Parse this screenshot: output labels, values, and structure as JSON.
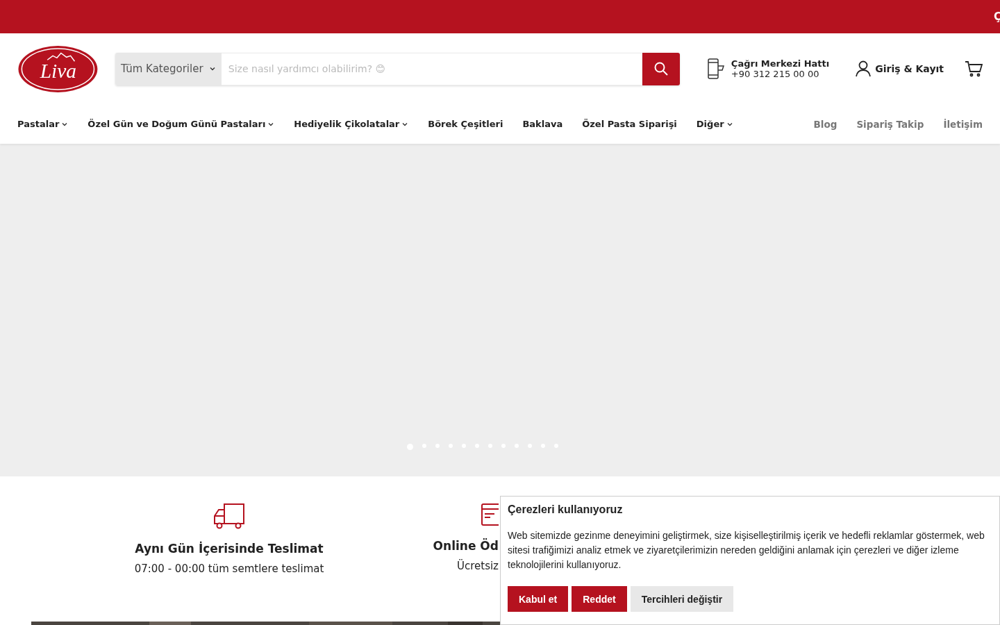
{
  "announcement_bar": {
    "text": "Ç"
  },
  "header": {
    "logo_text": "Liva",
    "category_select": "Tüm Kategoriler",
    "search": {
      "placeholder": "Size nasıl yardımcı olabilirim? 😊"
    },
    "call_center": {
      "title": "Çağrı Merkezi Hattı",
      "phone": "+90 312 215 00 00"
    },
    "account": "Giriş & Kayıt"
  },
  "nav": {
    "items": [
      {
        "label": "Pastalar",
        "has_menu": true
      },
      {
        "label": "Özel Gün ve Doğum Günü Pastaları",
        "has_menu": true
      },
      {
        "label": "Hediyelik Çikolatalar",
        "has_menu": true
      },
      {
        "label": "Börek Çeşitleri",
        "has_menu": false
      },
      {
        "label": "Baklava",
        "has_menu": false
      },
      {
        "label": "Özel Pasta Siparişi",
        "has_menu": false
      },
      {
        "label": "Diğer",
        "has_menu": true
      }
    ],
    "secondary": [
      "Blog",
      "Sipariş Takip",
      "İletişim"
    ]
  },
  "slider": {
    "dots": [
      {
        "selected": true
      },
      {
        "selected": false
      },
      {
        "selected": false
      },
      {
        "selected": false
      },
      {
        "selected": false
      },
      {
        "selected": false
      },
      {
        "selected": false
      },
      {
        "selected": false
      },
      {
        "selected": false
      },
      {
        "selected": false
      },
      {
        "selected": false
      },
      {
        "selected": false
      }
    ]
  },
  "features": [
    {
      "kind": "truck",
      "title": "Aynı Gün İçerisinde Teslimat",
      "text": "07:00 - 00:00 tüm semtlere teslimat"
    },
    {
      "kind": "card",
      "title": "Online Öd",
      "text": "Ücretsiz"
    }
  ],
  "cookie_dialog": {
    "title": "Çerezleri kullanıyoruz",
    "body": "Web sitemizde gezinme deneyimini geliştirmek, size kişiselleştirilmiş içerik ve hedefli reklamlar göstermek, web sitesi trafiğimizi analiz etmek ve ziyaretçilerimizin nereden geldiğini anlamak için çerezleri ve diğer izleme teknolojilerini kullanıyoruz.",
    "buttons": [
      {
        "label": "Kabul et",
        "kind": "primary"
      },
      {
        "label": "Reddet",
        "kind": "primary"
      },
      {
        "label": "Tercihleri değiştir",
        "kind": "secondary"
      }
    ]
  }
}
